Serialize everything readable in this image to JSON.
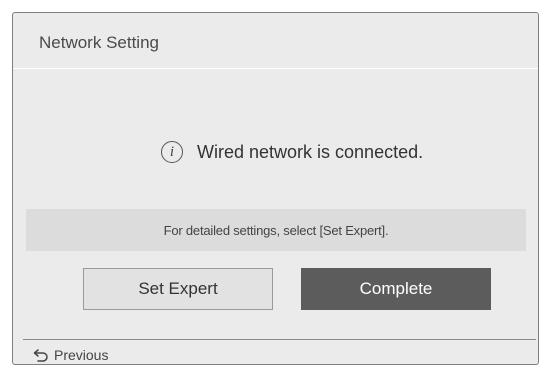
{
  "dialog": {
    "title": "Network Setting",
    "status_message": "Wired network is connected.",
    "info_icon": "info-icon",
    "info_glyph": "i",
    "hint": "For detailed settings, select [Set Expert].",
    "buttons": {
      "set_expert": "Set Expert",
      "complete": "Complete"
    },
    "footer": {
      "previous_label": "Previous",
      "previous_icon": "back-arrow-icon"
    }
  },
  "colors": {
    "panel_background": "#ebebeb",
    "hint_band": "#dcdcdc",
    "selected_button": "#5c5c5c",
    "unselected_button": "#e2e2e2"
  }
}
